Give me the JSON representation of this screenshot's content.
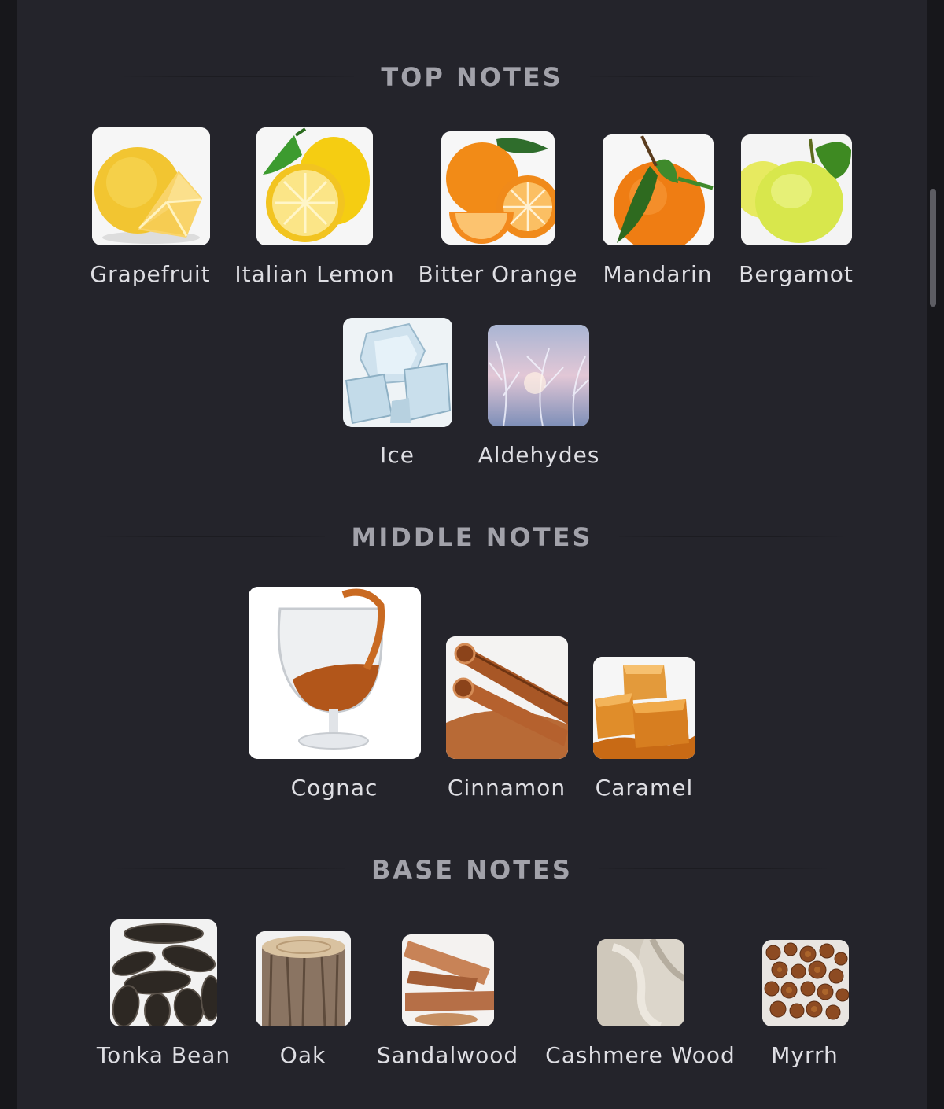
{
  "sections": {
    "top": {
      "title": "TOP NOTES",
      "notes": [
        {
          "name": "Grapefruit",
          "icon": "grapefruit-icon"
        },
        {
          "name": "Italian Lemon",
          "icon": "lemon-icon"
        },
        {
          "name": "Bitter Orange",
          "icon": "bitter-orange-icon"
        },
        {
          "name": "Mandarin",
          "icon": "mandarin-icon"
        },
        {
          "name": "Bergamot",
          "icon": "bergamot-icon"
        },
        {
          "name": "Ice",
          "icon": "ice-icon"
        },
        {
          "name": "Aldehydes",
          "icon": "aldehydes-icon"
        }
      ]
    },
    "middle": {
      "title": "MIDDLE NOTES",
      "notes": [
        {
          "name": "Cognac",
          "icon": "cognac-icon"
        },
        {
          "name": "Cinnamon",
          "icon": "cinnamon-icon"
        },
        {
          "name": "Caramel",
          "icon": "caramel-icon"
        }
      ]
    },
    "base": {
      "title": "BASE NOTES",
      "notes": [
        {
          "name": "Tonka Bean",
          "icon": "tonka-bean-icon"
        },
        {
          "name": "Oak",
          "icon": "oak-icon"
        },
        {
          "name": "Sandalwood",
          "icon": "sandalwood-icon"
        },
        {
          "name": "Cashmere Wood",
          "icon": "cashmere-wood-icon"
        },
        {
          "name": "Myrrh",
          "icon": "myrrh-icon"
        }
      ]
    }
  }
}
